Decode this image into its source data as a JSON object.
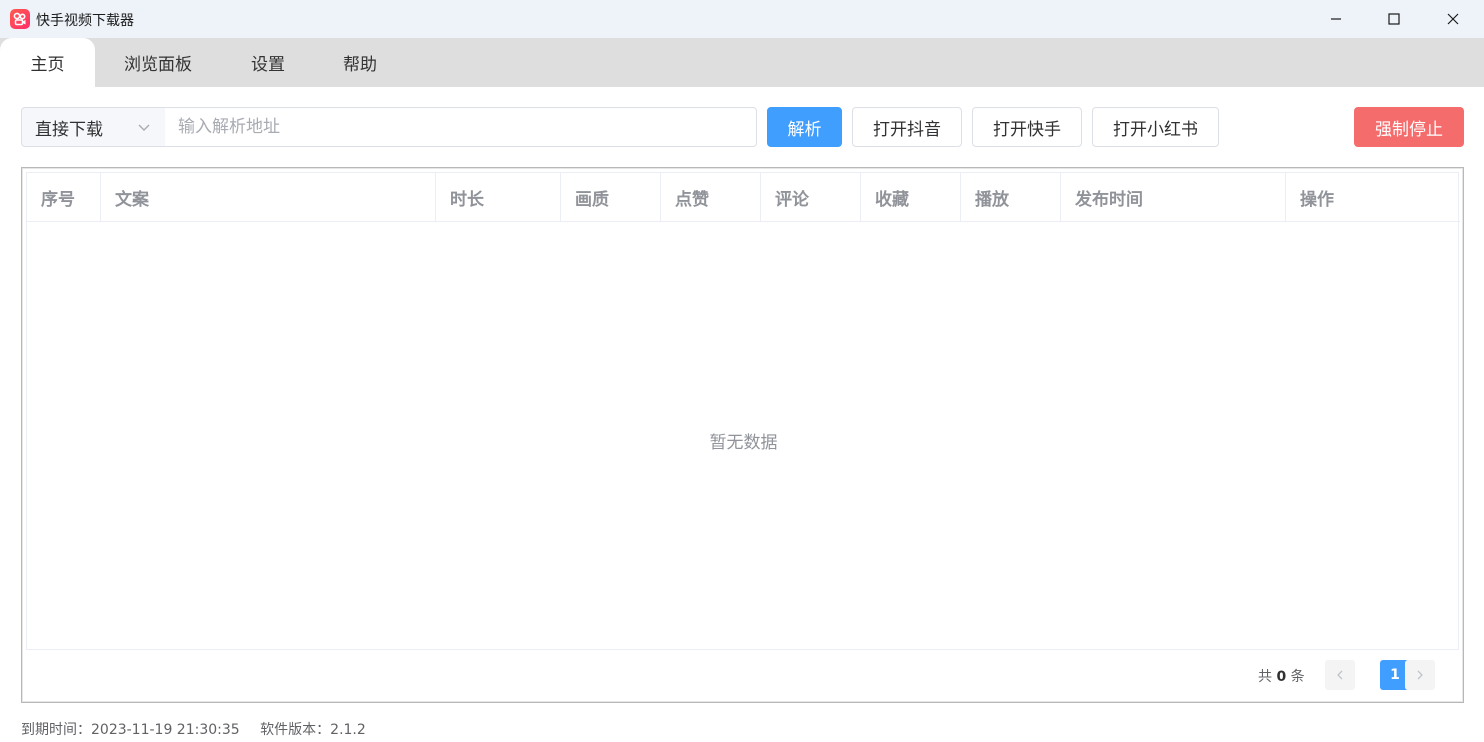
{
  "window": {
    "title": "快手视频下载器",
    "icon": "kuaishou-logo-icon"
  },
  "tabs": [
    {
      "label": "主页",
      "active": true
    },
    {
      "label": "浏览面板",
      "active": false
    },
    {
      "label": "设置",
      "active": false
    },
    {
      "label": "帮助",
      "active": false
    }
  ],
  "toolbar": {
    "mode_selected": "直接下载",
    "url_placeholder": "输入解析地址",
    "url_value": "",
    "parse_label": "解析",
    "open_douyin_label": "打开抖音",
    "open_kuaishou_label": "打开快手",
    "open_xhs_label": "打开小红书",
    "force_stop_label": "强制停止"
  },
  "table": {
    "columns": [
      "序号",
      "文案",
      "时长",
      "画质",
      "点赞",
      "评论",
      "收藏",
      "播放",
      "发布时间",
      "操作"
    ],
    "rows": [],
    "empty_text": "暂无数据"
  },
  "pagination": {
    "total_prefix": "共",
    "total_count": "0",
    "total_suffix": "条",
    "current_page": "1"
  },
  "status": {
    "expire_label": "到期时间：",
    "expire_value": "2023-11-19 21:30:35",
    "version_label": "软件版本：",
    "version_value": "2.1.2"
  },
  "colors": {
    "primary": "#409eff",
    "danger": "#f56c6c",
    "titlebar": "#eef3f9",
    "tabbar": "#dedede"
  }
}
